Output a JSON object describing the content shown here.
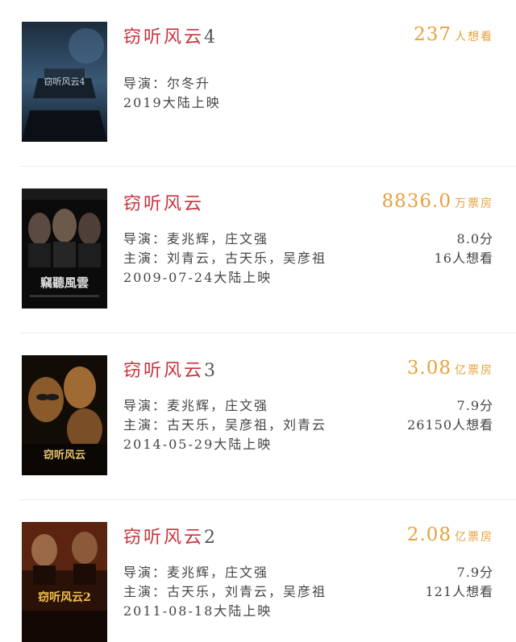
{
  "movies": [
    {
      "title_name": "窃听风云",
      "title_num": "4",
      "stat_value": "237",
      "stat_unit": "人想看",
      "director": "导演：尔冬升",
      "starring": "",
      "release": "2019大陆上映",
      "rating": "",
      "want": "",
      "poster": {
        "title_text": "窃听风云4",
        "accent": "#7da3c8"
      }
    },
    {
      "title_name": "窃听风云",
      "title_num": "",
      "stat_value": "8836.0",
      "stat_unit": "万票房",
      "director": "导演：麦兆辉，庄文强",
      "starring": "主演：刘青云，古天乐，吴彦祖",
      "release": "2009-07-24大陆上映",
      "rating": "8.0分",
      "want": "16人想看",
      "poster": {
        "title_text": "竊聽風雲",
        "accent": "#d9d9d9"
      }
    },
    {
      "title_name": "窃听风云",
      "title_num": "3",
      "stat_value": "3.08",
      "stat_unit": "亿票房",
      "director": "导演：麦兆辉，庄文强",
      "starring": "主演：古天乐，吴彦祖，刘青云",
      "release": "2014-05-29大陆上映",
      "rating": "7.9分",
      "want": "26150人想看",
      "poster": {
        "title_text": "窃听风云",
        "accent": "#e8c36a"
      }
    },
    {
      "title_name": "窃听风云",
      "title_num": "2",
      "stat_value": "2.08",
      "stat_unit": "亿票房",
      "director": "导演：麦兆辉，庄文强",
      "starring": "主演：古天乐，刘青云，吴彦祖",
      "release": "2011-08-18大陆上映",
      "rating": "7.9分",
      "want": "121人想看",
      "poster": {
        "title_text": "窃听风云2",
        "accent": "#e0b84a"
      }
    }
  ],
  "colors": {
    "title": "#c8323c",
    "stat": "#e6a23c",
    "divider": "#ececec"
  }
}
